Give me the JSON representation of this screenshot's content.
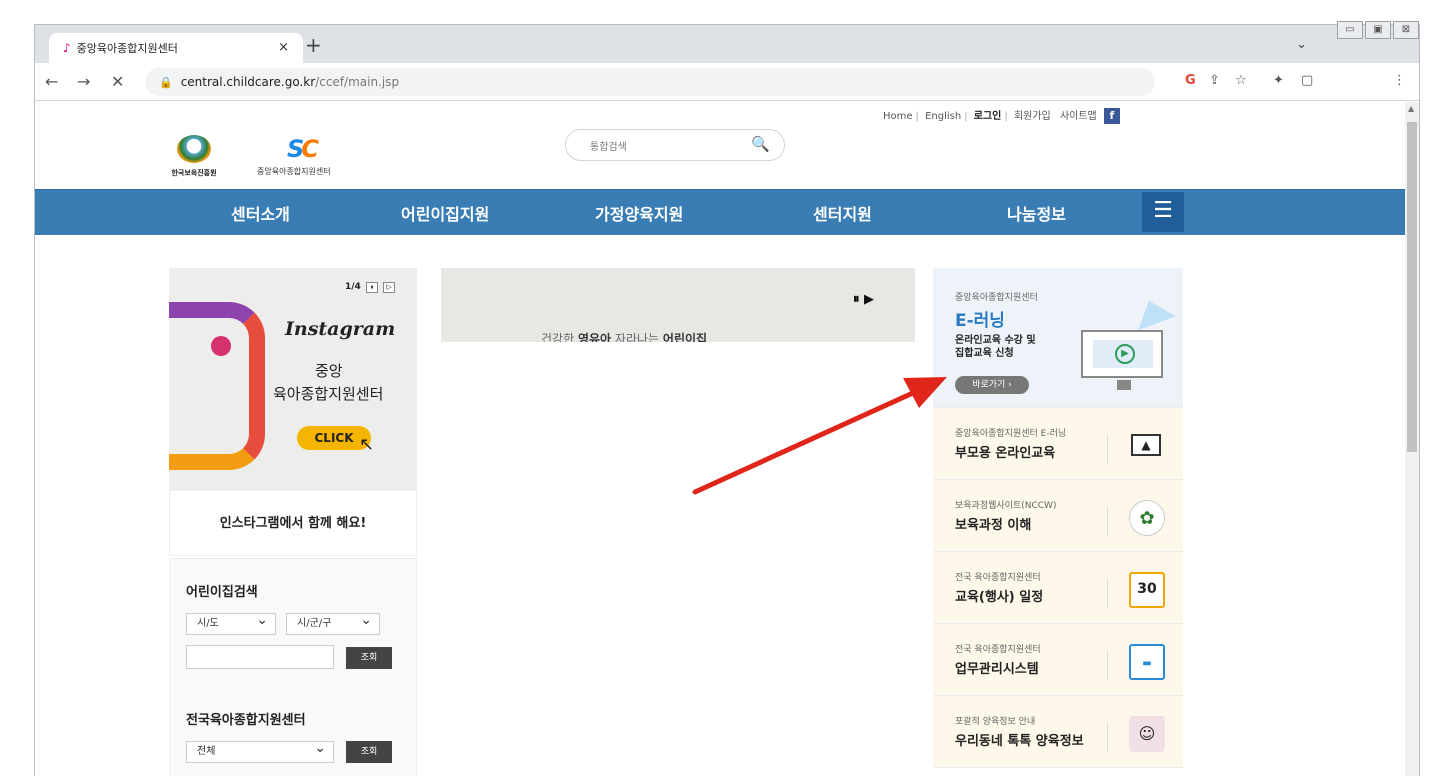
{
  "browser": {
    "tab_title": "중앙육아종합지원센터",
    "tab_close": "×",
    "new_tab": "+",
    "url_host": "central.childcare.go.kr",
    "url_path": "/ccef/main.jsp",
    "chevron": "⌄",
    "window_buttons": [
      "▭",
      "▣",
      "⊠"
    ],
    "nav_back": "←",
    "nav_forward": "→",
    "nav_stop": "✕",
    "lock": "🔒",
    "toolbar_icons": [
      "G",
      "⇪",
      "☆",
      "✦",
      "▢",
      "⋮"
    ]
  },
  "site": {
    "utility_links": [
      {
        "label": "Home",
        "bold": false
      },
      {
        "label": "English",
        "bold": false
      },
      {
        "label": "로그인",
        "bold": true
      },
      {
        "label": "회원가입",
        "bold": false
      },
      {
        "label": "사이트맵",
        "bold": false
      }
    ],
    "facebook": "f",
    "logo_kcpi": "한국보육진흥원",
    "logo_ccef_mark": "SC",
    "logo_ccef_text": "중앙육아종합지원센터",
    "search_placeholder": "통합검색",
    "search_icon": "🔍",
    "menu": [
      "센터소개",
      "어린이집지원",
      "가정양육지원",
      "센터지원",
      "나눔정보"
    ],
    "menu_button": "☰"
  },
  "instagram": {
    "page": "1/4",
    "controls": [
      "⏸",
      "▷"
    ],
    "brand": "Instagram",
    "line1": "중앙",
    "line2": "육아종합지원센터",
    "click": "CLICK",
    "cursor": "↖",
    "caption": "인스타그램에서 함께 해요!"
  },
  "finder": {
    "daycare_title": "어린이집검색",
    "select_sido": "시/도",
    "select_sigungu": "시/군/구",
    "search_button": "조회",
    "center_title": "전국육아종합지원센터",
    "select_all": "전체",
    "center_button": "조회"
  },
  "banner": {
    "controls": "⏸ ▶",
    "text_prefix": "건강한",
    "text_bold1": "영유아",
    "text_mid": "자라나는",
    "text_bold2": "어린이집"
  },
  "quick": {
    "elearning": {
      "small": "중앙육아종합지원센터",
      "title": "E-러닝",
      "sub1": "온라인교육 수강 및",
      "sub2": "집합교육 신청",
      "go": "바로가기 ›",
      "play": "▶"
    },
    "items": [
      {
        "small": "중앙육아종합지원센터 E-러닝",
        "big": "부모용 온라인교육",
        "icon": "monitor-icon",
        "glyph": "▲"
      },
      {
        "small": "보육과정웹사이트(NCCW)",
        "big": "보육과정 이해",
        "icon": "plant-icon",
        "glyph": "✿"
      },
      {
        "small": "전국 육아종합지원센터",
        "big": "교육(행사) 일정",
        "icon": "calendar-icon",
        "glyph": "30"
      },
      {
        "small": "전국 육아종합지원센터",
        "big": "업무관리시스템",
        "icon": "card-icon",
        "glyph": "▬"
      },
      {
        "small": "포괄적 양육정보 안내",
        "big": "우리동네 톡톡 양육정보",
        "icon": "family-icon",
        "glyph": "☺"
      }
    ]
  },
  "colors": {
    "nav_blue": "#3a7db5",
    "accent_arrow": "#e0251b",
    "instagram_pink": "#d6316f"
  }
}
